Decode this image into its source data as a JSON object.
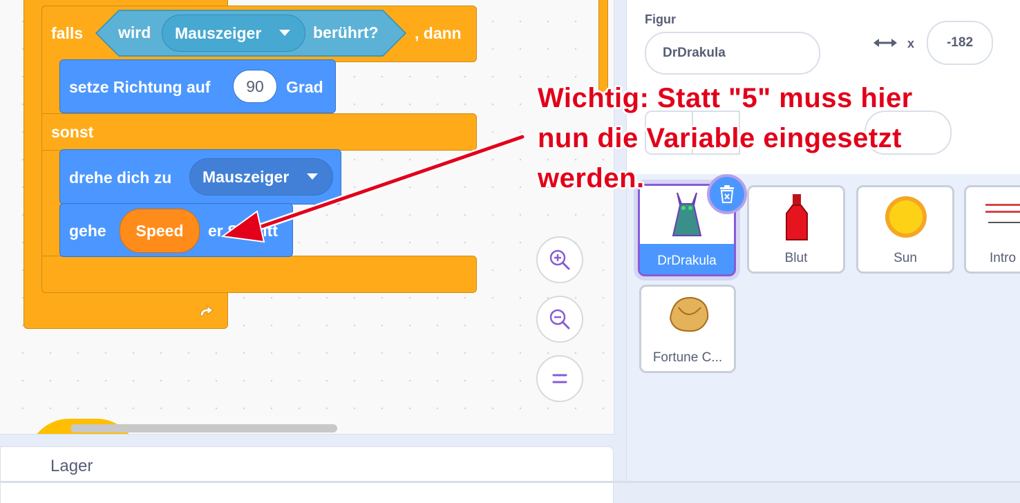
{
  "blocks": {
    "if_label": "falls",
    "touching_label": "wird",
    "touching_target": "Mauszeiger",
    "touching_suffix": "berührt?",
    "then_label": ", dann",
    "set_direction_label": "setze Richtung auf",
    "direction_value": "90",
    "degree_label": "Grad",
    "else_label": "sonst",
    "point_towards_label": "drehe dich zu",
    "point_towards_target": "Mauszeiger",
    "move_label": "gehe",
    "move_variable": "Speed",
    "move_suffix": "er Schritt"
  },
  "backpack": {
    "label": "Lager"
  },
  "sprite_info": {
    "label": "Figur",
    "name": "DrDrakula",
    "x_label": "x",
    "x_value": "-182"
  },
  "sprites": [
    {
      "name": "DrDrakula",
      "selected": true
    },
    {
      "name": "Blut"
    },
    {
      "name": "Sun"
    },
    {
      "name": "Intro"
    },
    {
      "name": "Fortune C..."
    }
  ],
  "annotation": {
    "line1": "Wichtig: Statt \"5\" muss hier",
    "line2": "nun die Variable eingesetzt",
    "line3": "werden."
  },
  "colors": {
    "control": "#ffab19",
    "motion": "#4c97ff",
    "sensing": "#5cb1d6",
    "variable": "#ff8c1a",
    "annotation": "#e2001a"
  }
}
